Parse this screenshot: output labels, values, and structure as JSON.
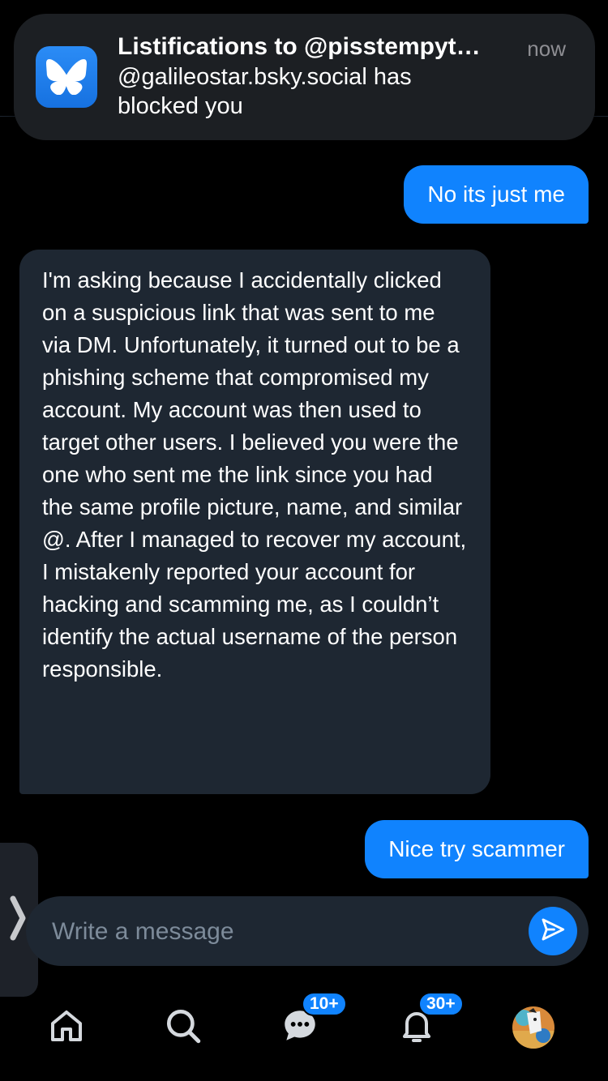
{
  "notification": {
    "app_icon": "bluesky-butterfly-icon",
    "title": "Listifications to @pisstempyt…",
    "time": "now",
    "body": "@galileostar.bsky.social has blocked you"
  },
  "messages": [
    {
      "direction": "outgoing",
      "text": "No its just me"
    },
    {
      "direction": "incoming",
      "text": "I'm asking because I accidentally clicked on a suspicious link that was sent to me via DM. Unfortunately, it turned out to be a phishing scheme that compromised my account. My account was then used to target other users. I believed you were the one who sent me the link since you had the same profile picture, name, and similar @. After I managed to recover my account, I mistakenly reported your account for hacking and scamming me, as I couldn’t identify the actual username of the person responsible."
    },
    {
      "direction": "outgoing",
      "text": "Nice try scammer"
    }
  ],
  "composer": {
    "placeholder": "Write a message",
    "send_icon": "send-icon"
  },
  "side_handle": {
    "icon": "chevron-right-icon"
  },
  "tabbar": {
    "items": [
      {
        "name": "home",
        "icon": "home-icon"
      },
      {
        "name": "search",
        "icon": "search-icon"
      },
      {
        "name": "chat",
        "icon": "chat-bubble-icon",
        "badge": "10+"
      },
      {
        "name": "notifications",
        "icon": "bell-icon",
        "badge": "30+"
      },
      {
        "name": "profile",
        "icon": "avatar"
      }
    ]
  },
  "colors": {
    "background": "#000000",
    "accent": "#1083fe",
    "incoming_bubble": "#1e2732",
    "placeholder": "#7d8b9a"
  }
}
